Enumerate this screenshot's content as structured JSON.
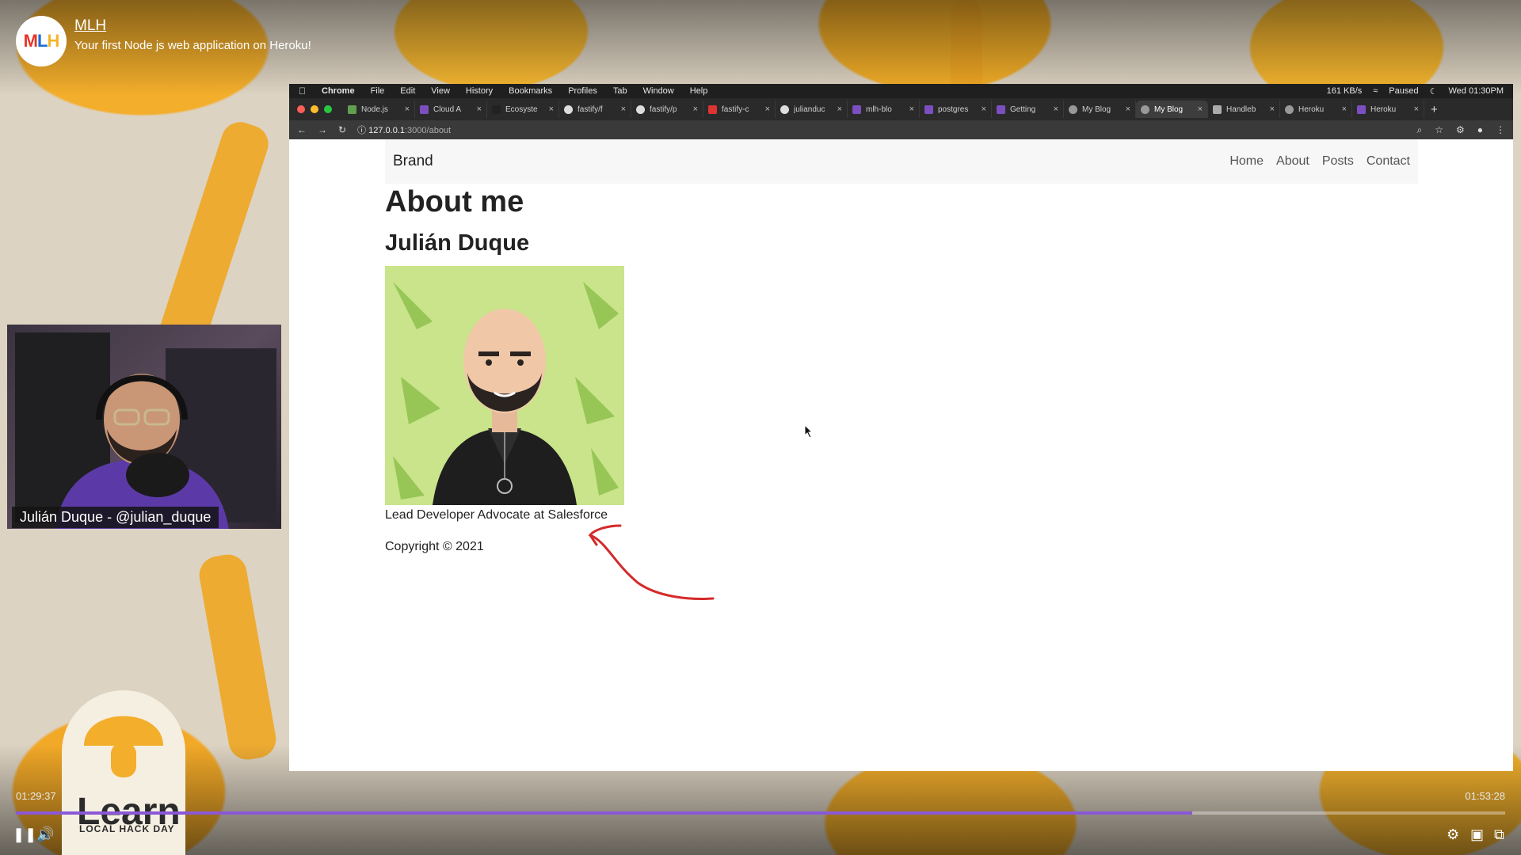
{
  "channel": {
    "logo_text": [
      "M",
      "L",
      "H"
    ],
    "name": "MLH",
    "video_title": "Your first Node js web application on Heroku!"
  },
  "mac_menubar": {
    "items": [
      "Chrome",
      "File",
      "Edit",
      "View",
      "History",
      "Bookmarks",
      "Profiles",
      "Tab",
      "Window",
      "Help"
    ],
    "status": [
      "161 KB/s",
      "Paused",
      "Wed 01:30PM"
    ]
  },
  "browser": {
    "tabs": [
      {
        "title": "Node.js",
        "active": false
      },
      {
        "title": "Cloud A",
        "active": false
      },
      {
        "title": "Ecosyste",
        "active": false
      },
      {
        "title": "fastify/f",
        "active": false
      },
      {
        "title": "fastify/p",
        "active": false
      },
      {
        "title": "fastify-c",
        "active": false
      },
      {
        "title": "julianduc",
        "active": false
      },
      {
        "title": "mlh-blo",
        "active": false
      },
      {
        "title": "postgres",
        "active": false
      },
      {
        "title": "Getting",
        "active": false
      },
      {
        "title": "My Blog",
        "active": false
      },
      {
        "title": "My Blog",
        "active": true
      },
      {
        "title": "Handleb",
        "active": false
      },
      {
        "title": "Heroku",
        "active": false
      },
      {
        "title": "Heroku",
        "active": false
      }
    ],
    "url_host": "127.0.0.1",
    "url_rest": ":3000/about"
  },
  "site": {
    "brand": "Brand",
    "nav": [
      "Home",
      "About",
      "Posts",
      "Contact"
    ],
    "heading": "About me",
    "name": "Julián Duque",
    "caption": "Lead Developer Advocate at Salesforce",
    "footer": "Copyright © 2021"
  },
  "webcam": {
    "name_tag": "Julián Duque - @julian_duque"
  },
  "learn_logo": {
    "word": "Learn",
    "sub": "LOCAL HACK DAY"
  },
  "player": {
    "current_time": "01:29:37",
    "duration": "01:53:28",
    "progress": 0.79
  },
  "colors": {
    "progress": "#8a58d6",
    "annotation": "#d42a2a"
  }
}
